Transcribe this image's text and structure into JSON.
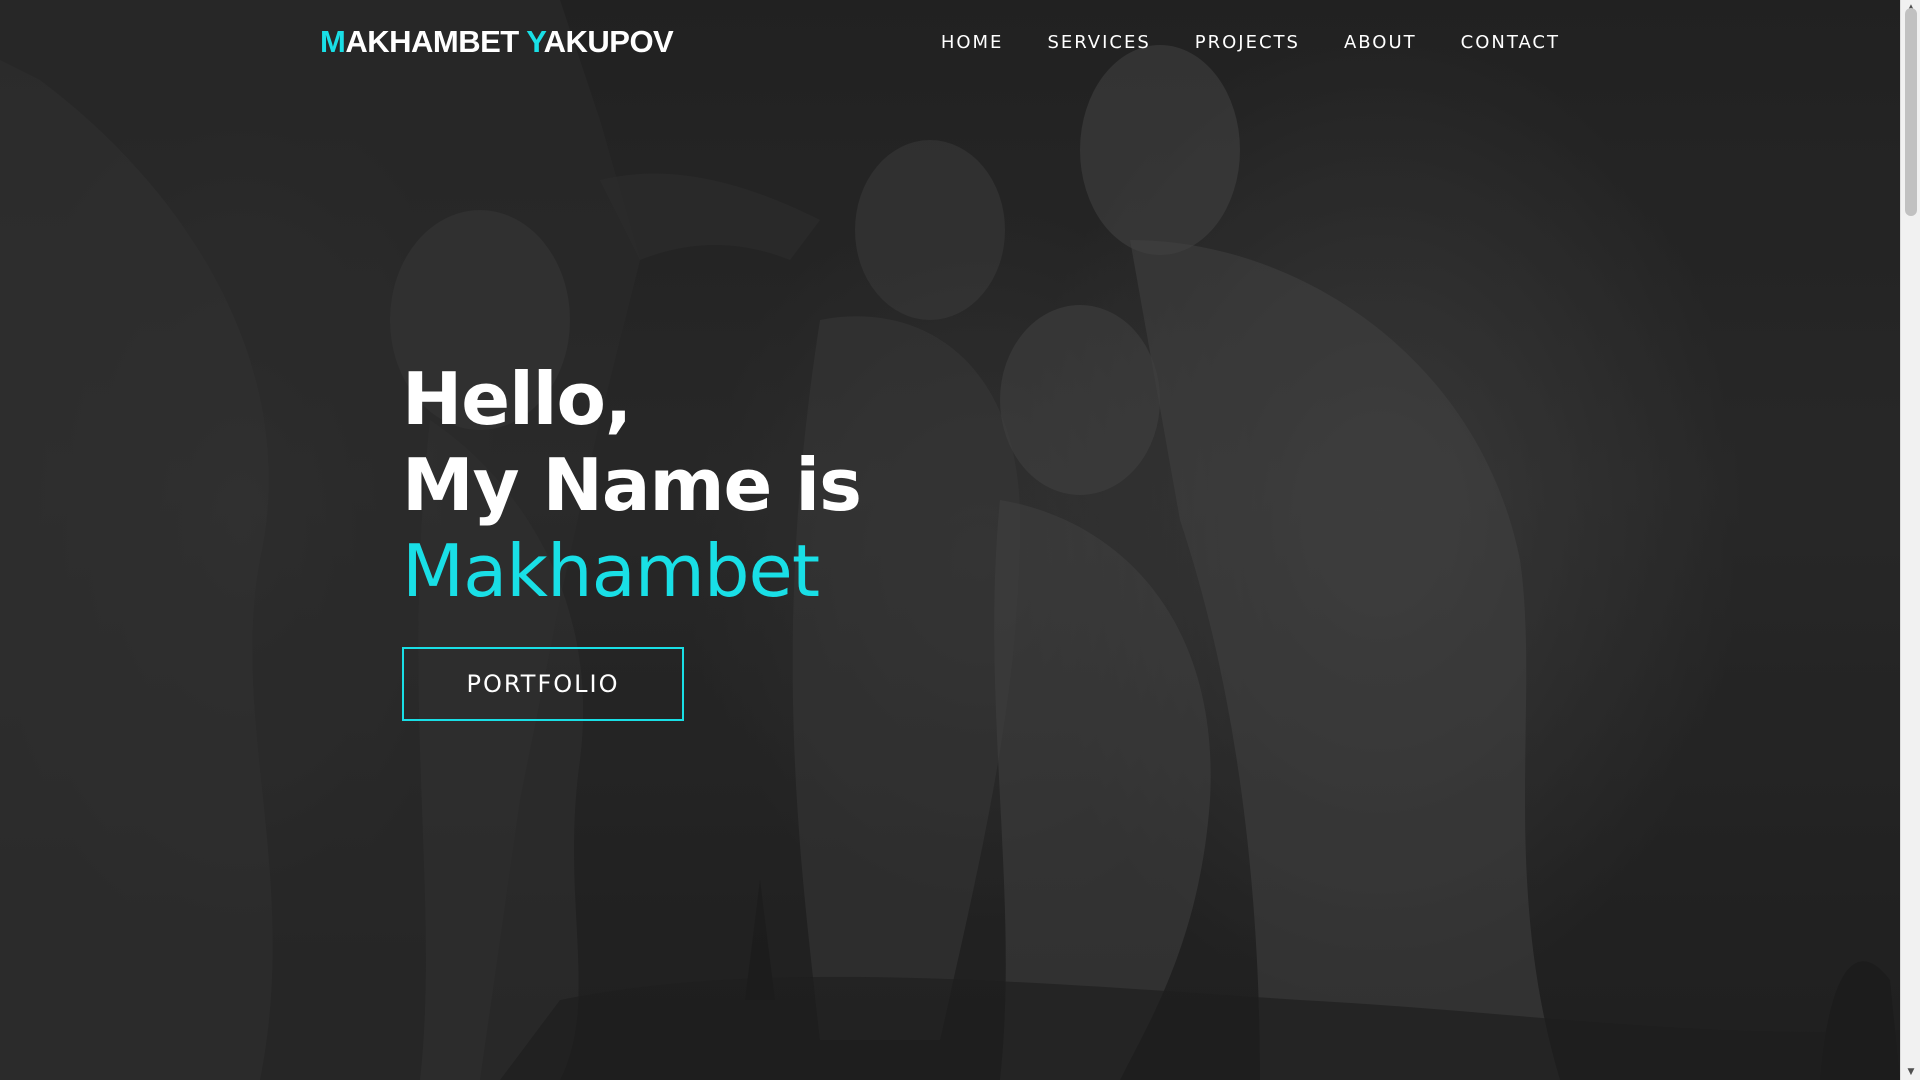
{
  "brand": {
    "first_initial": "M",
    "first_rest": "AKHAMBET ",
    "last_initial": "Y",
    "last_rest": "AKUPOV"
  },
  "nav": {
    "items": [
      {
        "label": "HOME"
      },
      {
        "label": "SERVICES"
      },
      {
        "label": "PROJECTS"
      },
      {
        "label": "ABOUT"
      },
      {
        "label": "CONTACT"
      }
    ]
  },
  "hero": {
    "line1": "Hello,",
    "line2": "My Name is",
    "name": "Makhambet",
    "button_label": "PORTFOLIO"
  },
  "colors": {
    "accent": "#19dfe6",
    "text": "#ffffff",
    "background": "#2d2d2d"
  }
}
